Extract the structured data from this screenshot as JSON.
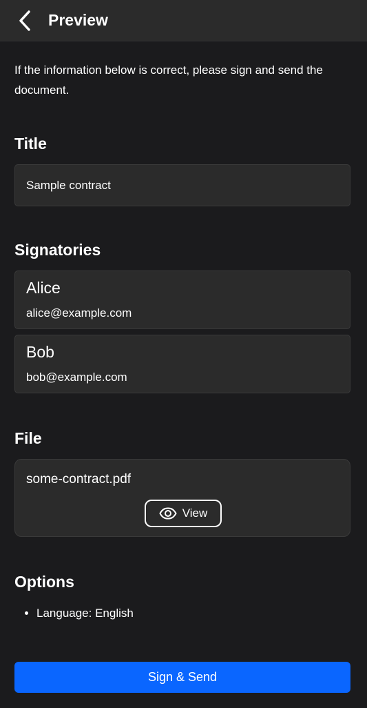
{
  "header": {
    "title": "Preview",
    "back_icon": "chevron-left-icon"
  },
  "intro": "If the information below is correct, please sign and send the document.",
  "title_section": {
    "heading": "Title",
    "value": "Sample contract"
  },
  "signatories_section": {
    "heading": "Signatories",
    "items": [
      {
        "name": "Alice",
        "email": "alice@example.com"
      },
      {
        "name": "Bob",
        "email": "bob@example.com"
      }
    ]
  },
  "file_section": {
    "heading": "File",
    "file_name": "some-contract.pdf",
    "view_label": "View",
    "view_icon": "eye-icon"
  },
  "options_section": {
    "heading": "Options",
    "items": [
      "Language: English"
    ]
  },
  "sign_button_label": "Sign & Send",
  "colors": {
    "accent": "#0a66ff",
    "background": "#1b1b1d",
    "card": "#2b2b2b"
  }
}
